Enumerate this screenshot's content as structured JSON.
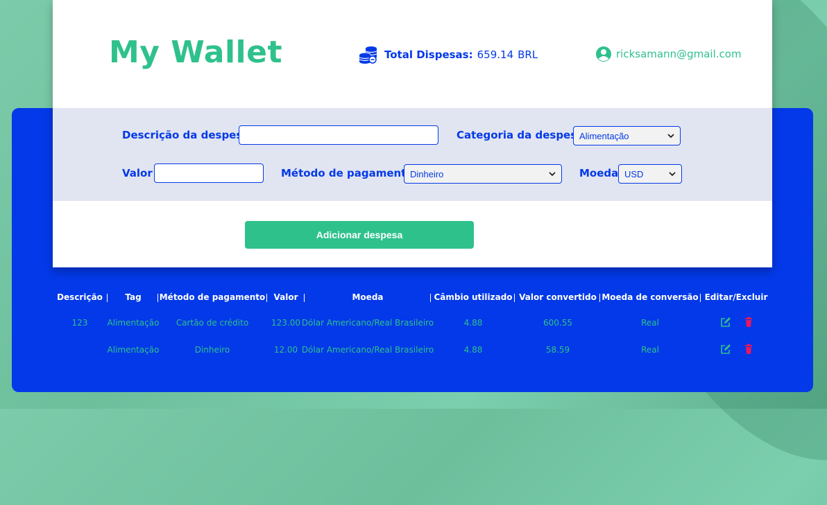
{
  "header": {
    "logo": "My Wallet",
    "total_label": "Total Dispesas:",
    "total_value": "659.14",
    "total_currency": "BRL",
    "user_email": "ricksamann@gmail.com"
  },
  "form": {
    "description_label": "Descrição da despesa",
    "description_value": "",
    "category_label": "Categoria da despesa",
    "category_value": "Alimentação",
    "value_label": "Valor",
    "value_value": "",
    "payment_label": "Método de pagamento",
    "payment_value": "Dinheiro",
    "currency_label": "Moeda",
    "currency_value": "USD",
    "add_button": "Adicionar despesa"
  },
  "table": {
    "headers": [
      "Descrição",
      "Tag",
      "Método de pagamento",
      "Valor",
      "Moeda",
      "Câmbio utilizado",
      "Valor convertido",
      "Moeda de conversão",
      "Editar/Excluir"
    ],
    "rows": [
      {
        "descricao": "123",
        "tag": "Alimentação",
        "metodo": "Cartão de crédito",
        "valor": "123.00",
        "moeda": "Dólar Americano/Real Brasileiro",
        "cambio": "4.88",
        "convertido": "600.55",
        "conversao": "Real"
      },
      {
        "descricao": "",
        "tag": "Alimentação",
        "metodo": "Dinheiro",
        "valor": "12.00",
        "moeda": "Dólar Americano/Real Brasileiro",
        "cambio": "4.88",
        "convertido": "58.59",
        "conversao": "Real"
      }
    ]
  },
  "colors": {
    "brand_green": "#2fc18c",
    "brand_blue": "#0339e8",
    "delete_red": "#e8175d"
  },
  "icons": [
    "coins-icon",
    "user-icon",
    "edit-icon",
    "trash-icon",
    "chevron-down-icon"
  ]
}
